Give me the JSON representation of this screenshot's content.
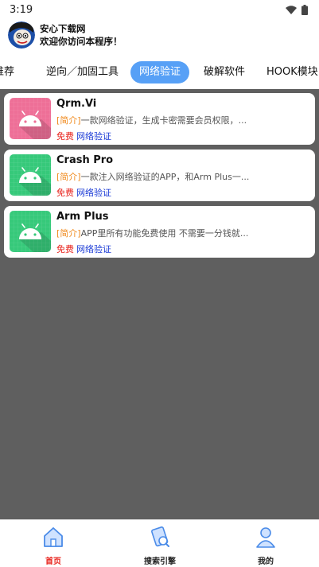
{
  "status_bar": {
    "time": "3:19"
  },
  "header": {
    "title": "安心下载网",
    "subtitle": "欢迎你访问本程序！"
  },
  "tabs": [
    {
      "label": "推荐"
    },
    {
      "label": "逆向／加固工具"
    },
    {
      "label": "网络验证",
      "active": true
    },
    {
      "label": "破解软件"
    },
    {
      "label": "HOOK模块"
    }
  ],
  "apps": [
    {
      "name": "Qrm.Vi",
      "desc_tag": "[简介]",
      "desc": "一款网络验证，生成卡密需要会员权限，...",
      "price": "免费",
      "category": "网络验证",
      "icon": "android-icon",
      "icon_color": "#ee6f97"
    },
    {
      "name": "Crash Pro",
      "desc_tag": "[简介]",
      "desc": "一款注入网络验证的APP，和Arm Plus一...",
      "price": "免费",
      "category": "网络验证",
      "icon": "android-icon",
      "icon_color": "#36c97a"
    },
    {
      "name": "Arm Plus",
      "desc_tag": "[简介]",
      "desc": "APP里所有功能免费使用 不需要一分钱就...",
      "price": "免费",
      "category": "网络验证",
      "icon": "android-icon",
      "icon_color": "#36c97a"
    }
  ],
  "bottom_nav": [
    {
      "label": "首页",
      "icon": "home-icon",
      "active": true
    },
    {
      "label": "搜索引擎",
      "icon": "search-engine-icon"
    },
    {
      "label": "我的",
      "icon": "profile-icon"
    }
  ],
  "colors": {
    "accent": "#57a0f6",
    "free": "#e8221b",
    "category": "#1a3ad6",
    "desc_tag": "#f08a1d",
    "content_bg": "#5f5f5f"
  }
}
